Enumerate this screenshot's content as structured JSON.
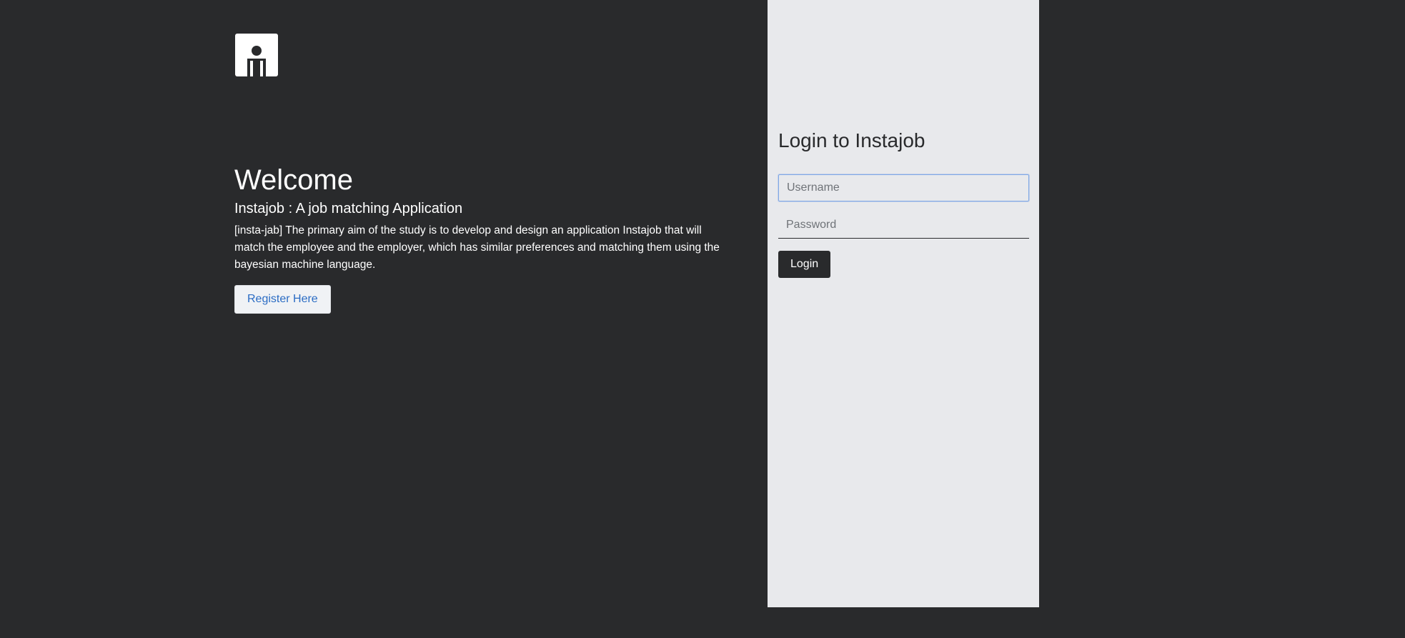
{
  "brand": {
    "logo_icon": "person-at-desk-icon"
  },
  "hero": {
    "title": "Welcome",
    "subtitle": "Instajob : A job matching Application",
    "description": "[insta-jab] The primary aim of the study is to develop and design an application Instajob that will match the employee and the employer, which has similar preferences and matching them using the bayesian machine language.",
    "register_label": "Register Here"
  },
  "login": {
    "title": "Login to Instajob",
    "username_placeholder": "Username",
    "username_value": "",
    "password_placeholder": "Password",
    "password_value": "",
    "submit_label": "Login"
  },
  "colors": {
    "background": "#292a2c",
    "panel": "#e8e9ec",
    "accent_link": "#2b6cc4",
    "focus_border": "#80a8e6"
  }
}
